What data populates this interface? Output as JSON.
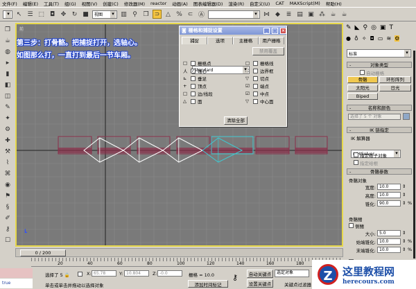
{
  "menu": [
    "文件(F)",
    "编辑(E)",
    "工具(T)",
    "组(G)",
    "视图(V)",
    "创建(C)",
    "修改器(M)",
    "reactor",
    "动画(A)",
    "图表编辑器(D)",
    "渲染(R)",
    "自定义(U)",
    "CAT",
    "MAXScript(M)",
    "帮助(H)"
  ],
  "toolbar": {
    "view_dropdown": "视图",
    "selection_set": ""
  },
  "viewport": {
    "label": "前",
    "instructions": [
      "第三步：打骨骼。把捕捉打开，选轴心。",
      "如图那么打，一直打到最后一节车厢。"
    ],
    "colors": {
      "background": "#7a7a7a",
      "boxes": "#8b2f4a",
      "bones": "#ffffff",
      "selected": "#40c8d0"
    }
  },
  "dialog": {
    "title": "栅格和捕捉设置",
    "tabs": [
      "捕捉",
      "选项",
      "主栅格",
      "用户栅格"
    ],
    "dropdown": "Standard",
    "override_button": "禁用覆盖",
    "left": [
      {
        "label": "栅格点",
        "checked": false
      },
      {
        "label": "轴心",
        "checked": true
      },
      {
        "label": "垂足",
        "checked": false
      },
      {
        "label": "顶点",
        "checked": false
      },
      {
        "label": "边/线段",
        "checked": false
      },
      {
        "label": "面",
        "checked": false
      }
    ],
    "right": [
      {
        "label": "栅格线",
        "checked": false
      },
      {
        "label": "边界框",
        "checked": false
      },
      {
        "label": "切点",
        "checked": false
      },
      {
        "label": "端点",
        "checked": false
      },
      {
        "label": "中点",
        "checked": false
      },
      {
        "label": "中心面",
        "checked": false
      }
    ],
    "clear_all": "清除全部"
  },
  "panel": {
    "category": "标准",
    "object_type": "对象类型",
    "auto_grid": "自动栅格",
    "bones": "骨骼",
    "ring_array": "环形阵列",
    "sunlight": "太阳光",
    "daylight": "日光",
    "biped": "Biped",
    "name_color": "名称和颜色",
    "name_value": "选择了 5 个 对象",
    "ik_chain": "IK 链指定",
    "ik_solver_label": "IK 解算器",
    "ik_solver": "IKHISolver",
    "assign_children": "指定给子对象",
    "assign_root": "指定给根",
    "bone_params": "骨骼参数",
    "bone_object": "骨骼对象",
    "width_label": "宽度:",
    "width": "10.0",
    "height_label": "高度:",
    "height": "10.0",
    "taper_label": "锥化:",
    "taper": "90.0",
    "fins": "骨骼鳍",
    "side_fins": "侧鳍",
    "size_label": "大小:",
    "size": "5.0",
    "start_taper_label": "始端锥化:",
    "start_taper": "10.0",
    "end_taper_label": "末端锥化:",
    "end_taper": "10.0",
    "pct": "%",
    "front_fin": "前鳍"
  },
  "bottom": {
    "frame": "0 / 200",
    "ticks": [
      "20",
      "40",
      "60",
      "80",
      "100",
      "120",
      "140",
      "160",
      "180"
    ],
    "selected": "选择了 5",
    "x_label": "X:",
    "x": "65.78",
    "y_label": "Y:",
    "y": "10.804",
    "z_label": "Z:",
    "z": "-0.0",
    "grid": "栅格 = 10.0",
    "auto_key": "自动关键点",
    "set_key": "设置关键点",
    "key_mode": "选定对象",
    "key_filters": "关键点过滤器",
    "prompt": "单击或单击并拖动以选择对象",
    "add_time_tag": "添加时间标记",
    "script_text": "true"
  },
  "watermark": {
    "title": "这里教程网",
    "url": "herecours.com"
  }
}
